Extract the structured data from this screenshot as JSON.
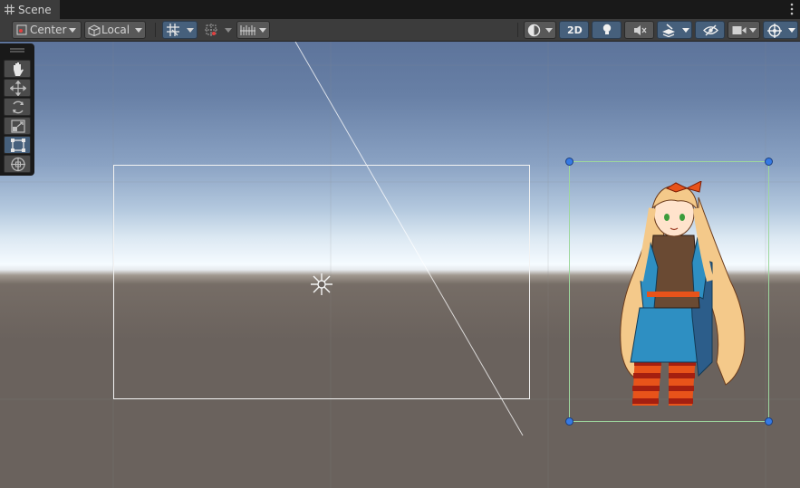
{
  "window": {
    "tab_title": "Scene"
  },
  "toolbar": {
    "pivot_label": "Center",
    "space_label": "Local",
    "mode_2d_label": "2D"
  },
  "icons": {
    "tab": "grid-icon",
    "menu": "kebab-icon",
    "pivot": "pivot-icon",
    "space": "cube-icon",
    "grid_snap": "grid-snap-icon",
    "increment_snap": "increment-snap-icon",
    "ruler": "ruler-icon",
    "draw_mode": "shading-mode-icon",
    "lighting": "lightbulb-icon",
    "audio": "speaker-muted-icon",
    "effects": "effects-icon",
    "visibility": "hidden-eye-icon",
    "camera": "camera-icon",
    "gizmos": "gizmo-icon"
  },
  "tools": [
    "hand",
    "move",
    "rotate",
    "scale",
    "rect",
    "transform"
  ],
  "active_tool": "rect",
  "colors": {
    "active_button": "#46607c",
    "selection_outline": "#9ed79e",
    "handle": "#3579e4",
    "toolbar": "#3c3c3c"
  }
}
